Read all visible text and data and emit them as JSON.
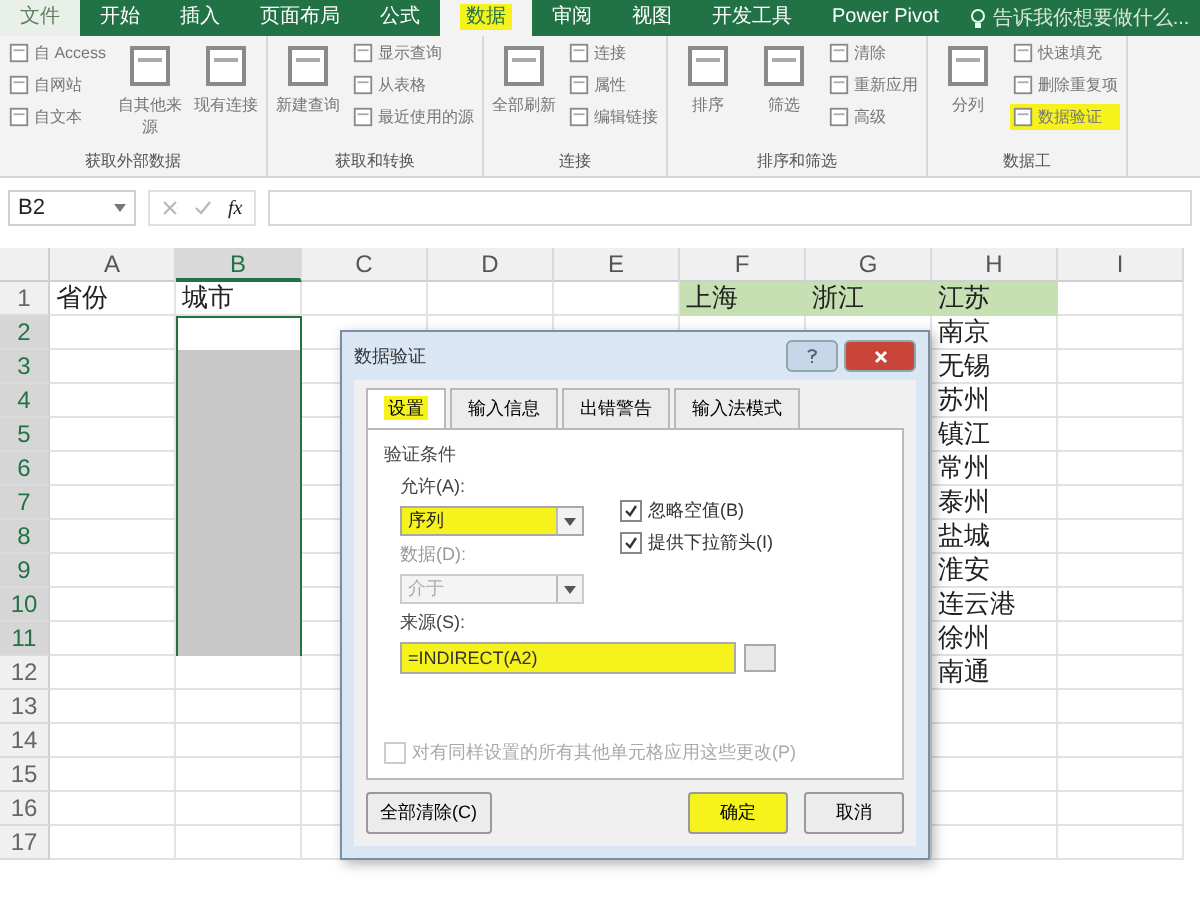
{
  "ribbon_tabs": [
    {
      "label": "文件",
      "selected": false,
      "kind": "file",
      "highlighted": false
    },
    {
      "label": "开始",
      "selected": false,
      "kind": "tab",
      "highlighted": false
    },
    {
      "label": "插入",
      "selected": false,
      "kind": "tab",
      "highlighted": false
    },
    {
      "label": "页面布局",
      "selected": false,
      "kind": "tab",
      "highlighted": false
    },
    {
      "label": "公式",
      "selected": false,
      "kind": "tab",
      "highlighted": false
    },
    {
      "label": "数据",
      "selected": true,
      "kind": "tab",
      "highlighted": true
    },
    {
      "label": "审阅",
      "selected": false,
      "kind": "tab",
      "highlighted": false
    },
    {
      "label": "视图",
      "selected": false,
      "kind": "tab",
      "highlighted": false
    },
    {
      "label": "开发工具",
      "selected": false,
      "kind": "tab",
      "highlighted": false
    },
    {
      "label": "Power Pivot",
      "selected": false,
      "kind": "tab",
      "highlighted": false
    }
  ],
  "tell_me": {
    "placeholder": "告诉我你想要做什么..."
  },
  "ribbon_groups": [
    {
      "label": "获取外部数据",
      "items": [
        {
          "label": "自 Access",
          "kind": "small",
          "highlighted": false
        },
        {
          "label": "自网站",
          "kind": "small",
          "highlighted": false
        },
        {
          "label": "自文本",
          "kind": "small",
          "highlighted": false
        },
        {
          "label": "自其他来源",
          "kind": "large",
          "highlighted": false
        },
        {
          "label": "现有连接",
          "kind": "large",
          "highlighted": false
        }
      ]
    },
    {
      "label": "获取和转换",
      "items": [
        {
          "label": "新建查询",
          "kind": "large",
          "highlighted": false
        },
        {
          "label": "显示查询",
          "kind": "small",
          "highlighted": false
        },
        {
          "label": "从表格",
          "kind": "small",
          "highlighted": false
        },
        {
          "label": "最近使用的源",
          "kind": "small",
          "highlighted": false
        }
      ]
    },
    {
      "label": "连接",
      "items": [
        {
          "label": "全部刷新",
          "kind": "large",
          "highlighted": false
        },
        {
          "label": "连接",
          "kind": "small",
          "highlighted": false
        },
        {
          "label": "属性",
          "kind": "small",
          "highlighted": false
        },
        {
          "label": "编辑链接",
          "kind": "small",
          "highlighted": false
        }
      ]
    },
    {
      "label": "排序和筛选",
      "items": [
        {
          "label": "排序",
          "kind": "large",
          "highlighted": false
        },
        {
          "label": "筛选",
          "kind": "large",
          "highlighted": false
        },
        {
          "label": "清除",
          "kind": "small",
          "highlighted": false
        },
        {
          "label": "重新应用",
          "kind": "small",
          "highlighted": false
        },
        {
          "label": "高级",
          "kind": "small",
          "highlighted": false
        }
      ]
    },
    {
      "label": "数据工",
      "items": [
        {
          "label": "分列",
          "kind": "large",
          "highlighted": false
        },
        {
          "label": "快速填充",
          "kind": "small",
          "highlighted": false
        },
        {
          "label": "删除重复项",
          "kind": "small",
          "highlighted": false
        },
        {
          "label": "数据验证",
          "kind": "small",
          "highlighted": true
        }
      ]
    }
  ],
  "formula_bar": {
    "name_box": "B2",
    "function_label": "fx"
  },
  "columns": [
    {
      "label": "A",
      "selected": false
    },
    {
      "label": "B",
      "selected": true
    },
    {
      "label": "C",
      "selected": false
    },
    {
      "label": "D",
      "selected": false
    },
    {
      "label": "E",
      "selected": false
    },
    {
      "label": "F",
      "selected": false
    },
    {
      "label": "G",
      "selected": false
    },
    {
      "label": "H",
      "selected": false
    },
    {
      "label": "I",
      "selected": false
    }
  ],
  "rows": [
    {
      "label": "1",
      "selected": false,
      "cells": {
        "A": {
          "text": "省份"
        },
        "B": {
          "text": "城市"
        },
        "F": {
          "text": "上海",
          "color": "#c6e0b4"
        },
        "G": {
          "text": "浙江",
          "color": "#c6e0b4"
        },
        "H": {
          "text": "江苏",
          "color": "#c6e0b4"
        }
      }
    },
    {
      "label": "2",
      "selected": true,
      "cells": {
        "H": {
          "text": "南京"
        }
      }
    },
    {
      "label": "3",
      "selected": true,
      "cells": {
        "H": {
          "text": "无锡"
        }
      }
    },
    {
      "label": "4",
      "selected": true,
      "cells": {
        "H": {
          "text": "苏州"
        }
      }
    },
    {
      "label": "5",
      "selected": true,
      "cells": {
        "H": {
          "text": "镇江"
        }
      }
    },
    {
      "label": "6",
      "selected": true,
      "cells": {
        "H": {
          "text": "常州"
        }
      }
    },
    {
      "label": "7",
      "selected": true,
      "cells": {
        "H": {
          "text": "泰州"
        }
      }
    },
    {
      "label": "8",
      "selected": true,
      "cells": {
        "H": {
          "text": "盐城"
        }
      }
    },
    {
      "label": "9",
      "selected": true,
      "cells": {
        "H": {
          "text": "淮安"
        }
      }
    },
    {
      "label": "10",
      "selected": true,
      "cells": {
        "H": {
          "text": "连云港"
        }
      }
    },
    {
      "label": "11",
      "selected": true,
      "cells": {
        "H": {
          "text": "徐州"
        }
      }
    },
    {
      "label": "12",
      "selected": false,
      "cells": {
        "H": {
          "text": "南通"
        }
      }
    },
    {
      "label": "13",
      "selected": false
    },
    {
      "label": "14",
      "selected": false
    },
    {
      "label": "15",
      "selected": false
    },
    {
      "label": "16",
      "selected": false
    },
    {
      "label": "17",
      "selected": false
    }
  ],
  "dialog": {
    "title": "数据验证",
    "tabs": [
      {
        "label": "设置",
        "selected": true,
        "highlighted": true
      },
      {
        "label": "输入信息",
        "selected": false,
        "highlighted": false
      },
      {
        "label": "出错警告",
        "selected": false,
        "highlighted": false
      },
      {
        "label": "输入法模式",
        "selected": false,
        "highlighted": false
      }
    ],
    "group_label": "验证条件",
    "allow": {
      "label": "允许(A):",
      "value": "序列",
      "highlighted": true,
      "disabled": false
    },
    "checkboxes": [
      {
        "label": "忽略空值(B)",
        "checked": true,
        "disabled": false
      },
      {
        "label": "提供下拉箭头(I)",
        "checked": true,
        "disabled": false
      }
    ],
    "data": {
      "label": "数据(D):",
      "value": "介于",
      "highlighted": false,
      "disabled": true
    },
    "source": {
      "label": "来源(S):",
      "value": "=INDIRECT(A2)",
      "highlighted": true
    },
    "apply_all": {
      "label": "对有同样设置的所有其他单元格应用这些更改(P)",
      "checked": false,
      "disabled": true
    },
    "buttons": [
      {
        "label": "全部清除(C)",
        "highlighted": false
      },
      {
        "label": "确定",
        "highlighted": true
      },
      {
        "label": "取消",
        "highlighted": false
      }
    ]
  }
}
